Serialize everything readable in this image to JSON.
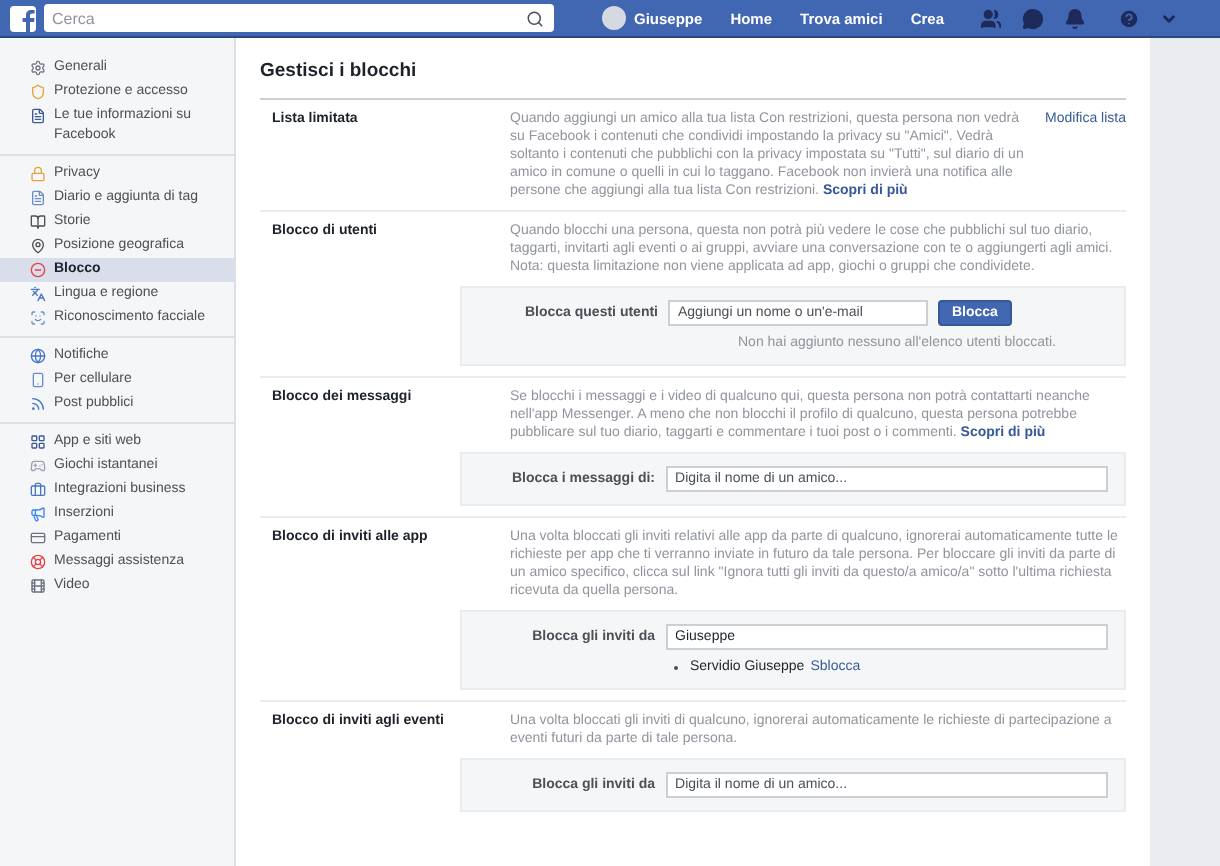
{
  "topbar": {
    "search": {
      "placeholder": "Cerca"
    },
    "profile": "Giuseppe",
    "links": [
      "Home",
      "Trova amici",
      "Crea"
    ]
  },
  "sidebar": {
    "groups": [
      [
        {
          "label": "Generali",
          "selected": false
        },
        {
          "label": "Protezione e accesso",
          "selected": false
        },
        {
          "label": "Le tue informazioni su Facebook",
          "selected": false
        }
      ],
      [
        {
          "label": "Privacy",
          "selected": false
        },
        {
          "label": "Diario e aggiunta di tag",
          "selected": false
        },
        {
          "label": "Storie",
          "selected": false
        },
        {
          "label": "Posizione geografica",
          "selected": false
        },
        {
          "label": "Blocco",
          "selected": true
        },
        {
          "label": "Lingua e regione",
          "selected": false
        },
        {
          "label": "Riconoscimento facciale",
          "selected": false
        }
      ],
      [
        {
          "label": "Notifiche",
          "selected": false
        },
        {
          "label": "Per cellulare",
          "selected": false
        },
        {
          "label": "Post pubblici",
          "selected": false
        }
      ],
      [
        {
          "label": "App e siti web",
          "selected": false
        },
        {
          "label": "Giochi istantanei",
          "selected": false
        },
        {
          "label": "Integrazioni business",
          "selected": false
        },
        {
          "label": "Inserzioni",
          "selected": false
        },
        {
          "label": "Pagamenti",
          "selected": false
        },
        {
          "label": "Messaggi assistenza",
          "selected": false
        },
        {
          "label": "Video",
          "selected": false
        }
      ]
    ]
  },
  "main": {
    "title": "Gestisci i blocchi",
    "sections": [
      {
        "title": "Lista limitata",
        "description": "Quando aggiungi un amico alla tua lista Con restrizioni, questa persona non vedrà su Facebook i contenuti che condividi impostando la privacy su \"Amici\". Vedrà soltanto i contenuti che pubblichi con la privacy impostata su \"Tutti\", sul diario di un amico in comune o quelli in cui lo taggano. Facebook non invierà una notifica alle persone che aggiungi alla tua lista Con restrizioni.",
        "link": "Scopri di più",
        "side_link": "Modifica lista"
      },
      {
        "title": "Blocco di utenti",
        "description": "Quando blocchi una persona, questa non potrà più vedere le cose che pubblichi sul tuo diario, taggarti, invitarti agli eventi o ai gruppi, avviare una conversazione con te o aggiungerti agli amici. Nota: questa limitazione non viene applicata ad app, giochi o gruppi che condividete.",
        "form": {
          "label": "Blocca questi utenti",
          "placeholder": "Aggiungi un nome o un'e-mail",
          "button": "Blocca",
          "note": "Non hai aggiunto nessuno all'elenco utenti bloccati."
        }
      },
      {
        "title": "Blocco dei messaggi",
        "description": "Se blocchi i messaggi e i video di qualcuno qui, questa persona non potrà contattarti neanche nell'app Messenger. A meno che non blocchi il profilo di qualcuno, questa persona potrebbe pubblicare sul tuo diario, taggarti e commentare i tuoi post o i commenti.",
        "link": "Scopri di più",
        "form": {
          "label": "Blocca i messaggi di:",
          "placeholder": "Digita il nome di un amico..."
        }
      },
      {
        "title": "Blocco di inviti alle app",
        "description": "Una volta bloccati gli inviti relativi alle app da parte di qualcuno, ignorerai automaticamente tutte le richieste per app che ti verranno inviate in futuro da tale persona. Per bloccare gli inviti da parte di un amico specifico, clicca sul link \"Ignora tutti gli inviti da questo/a amico/a\" sotto l'ultima richiesta ricevuta da quella persona.",
        "form": {
          "label": "Blocca gli inviti da",
          "value": "Giuseppe",
          "blocked": [
            {
              "name": "Servidio Giuseppe",
              "action": "Sblocca"
            }
          ]
        }
      },
      {
        "title": "Blocco di inviti agli eventi",
        "description": "Una volta bloccati gli inviti di qualcuno, ignorerai automaticamente le richieste di partecipazione a eventi futuri da parte di tale persona.",
        "form": {
          "label": "Blocca gli inviti da",
          "placeholder": "Digita il nome di un amico..."
        }
      }
    ]
  }
}
